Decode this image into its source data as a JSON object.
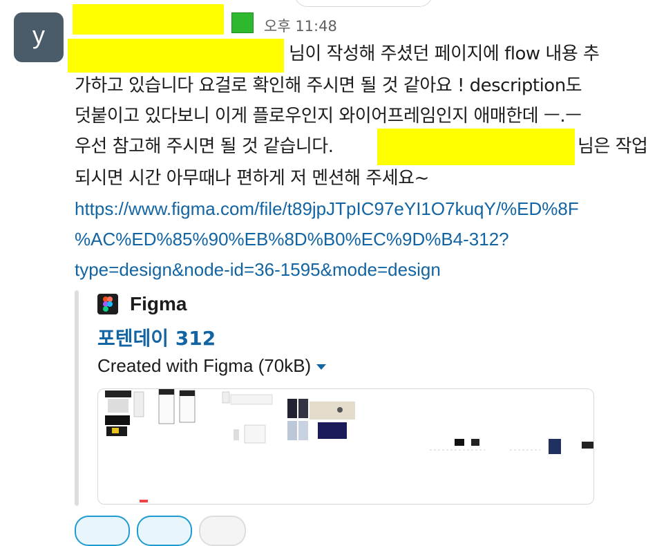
{
  "author": {
    "avatar_letter": "y"
  },
  "message": {
    "timestamp": "오후 11:48",
    "lines": [
      "님이 작성해 주셨던 페이지에 flow 내용 추",
      "가하고 있습니다 요걸로 확인해 주시면 될 것 같아요 ! description도",
      "덧붙이고 있다보니 이게 플로우인지 와이어프레임인지 애매한데 ㅡ.ㅡ",
      "우선 참고해 주시면 될 것 같습니다.",
      "님은 작업",
      "되시면 시간 아무때나 편하게 저 멘션해 주세요~"
    ],
    "link_lines": [
      "https://www.figma.com/file/t89jpJTpIC97eYI1O7kuqY/%ED%8F",
      "%AC%ED%85%90%EB%8D%B0%EC%9D%B4-312?",
      "type=design&node-id=36-1595&mode=design"
    ]
  },
  "attachment": {
    "provider": "Figma",
    "title": "포텐데이 312",
    "file_meta": "Created with Figma (70kB)",
    "icon": "figma-logo-icon"
  },
  "colors": {
    "link": "#1264a3",
    "avatar_bg": "#4a5b69",
    "redaction": "#ffff00",
    "status": "#2eb82e"
  }
}
